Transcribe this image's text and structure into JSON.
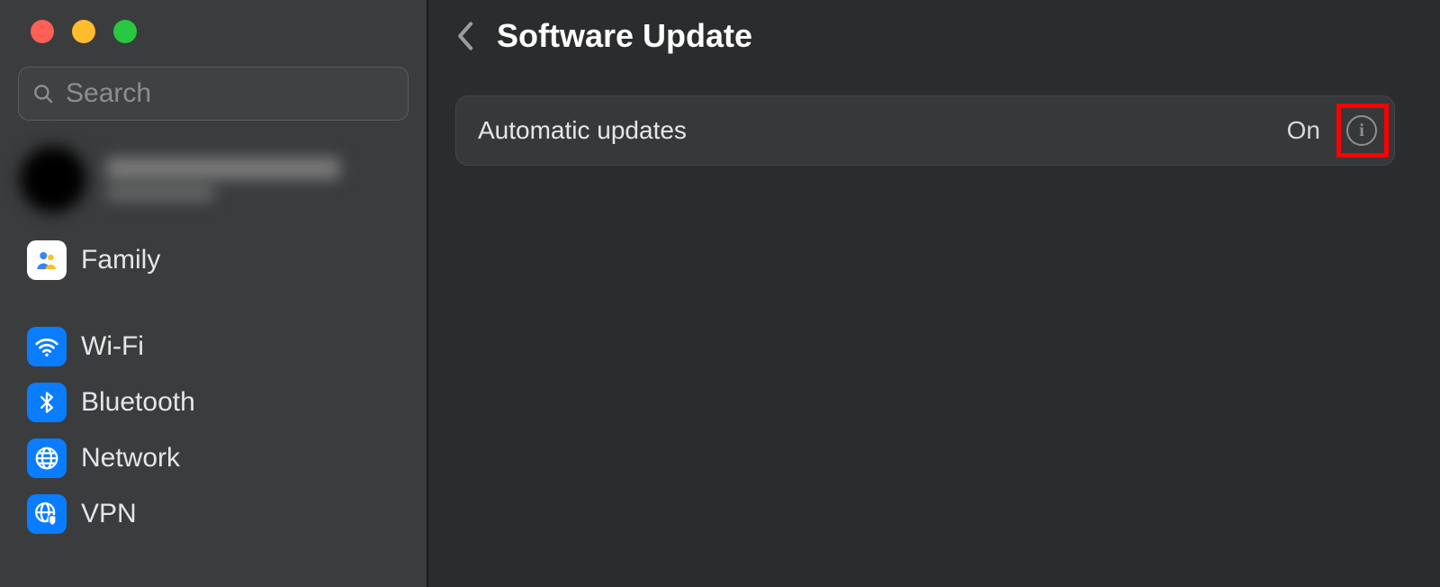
{
  "search": {
    "placeholder": "Search"
  },
  "sidebar": {
    "items": [
      {
        "label": "Family",
        "icon_name": "family-icon"
      },
      {
        "label": "Wi-Fi",
        "icon_name": "wifi-icon"
      },
      {
        "label": "Bluetooth",
        "icon_name": "bluetooth-icon"
      },
      {
        "label": "Network",
        "icon_name": "network-icon"
      },
      {
        "label": "VPN",
        "icon_name": "vpn-icon"
      }
    ]
  },
  "header": {
    "title": "Software Update"
  },
  "settings": {
    "automatic_updates": {
      "label": "Automatic updates",
      "value": "On"
    }
  }
}
